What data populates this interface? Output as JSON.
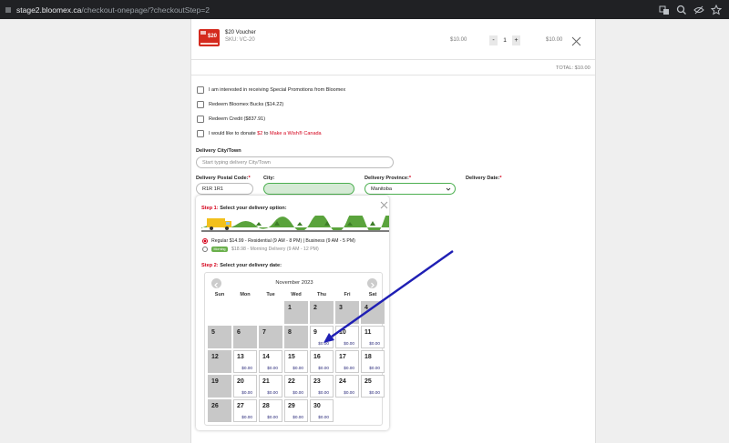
{
  "browser": {
    "url_host": "stage2.bloomex.ca",
    "url_path": "/checkout-onepage/?checkoutStep=2"
  },
  "cart": {
    "item_name": "$20 Voucher",
    "item_sku": "SKU: VC-20",
    "voucher_image_text": "$20",
    "unit_price": "$10.00",
    "qty_minus": "-",
    "quantity": "1",
    "qty_plus": "+",
    "line_total": "$10.00",
    "total": "TOTAL: $10.00"
  },
  "options": {
    "promotions": "I am interested in receiving Special Promotions from Bloomex",
    "bucks": "Redeem Bloomex Bucks ($14.22)",
    "credit": "Redeem Credit ($837.91)",
    "donate_pre": "I would like to donate ",
    "donate_amount": "$2",
    "donate_mid": " to ",
    "donate_org": "Make a Wish® Canada"
  },
  "delivery": {
    "city_town_label": "Delivery City/Town",
    "city_town_placeholder": "Start typing delivery City/Town",
    "postal_label": "Delivery Postal Code:",
    "postal_value": "R1R 1R1",
    "city_label": "City:",
    "province_label": "Delivery Province:",
    "province_value": "Manitoba",
    "date_label": "Delivery Date:",
    "required_mark": "*"
  },
  "step1": {
    "step_word": "Step 1:",
    "title": " Select your delivery option:",
    "option_regular": "Regular $14.99 - Residential (9 AM - 8 PM) | Business (9 AM - 5 PM)",
    "option_morning": "$18.98 - Morning Delivery (9 AM - 12 PM)",
    "morning_badge": "Morning"
  },
  "step2": {
    "step_word": "Step 2:",
    "title": " Select your delivery date:"
  },
  "calendar": {
    "month": "November 2023",
    "weekdays": [
      "Sun",
      "Mon",
      "Tue",
      "Wed",
      "Thu",
      "Fri",
      "Sat"
    ],
    "weeks": [
      [
        null,
        null,
        null,
        {
          "day": "1",
          "price": "",
          "disabled": true
        },
        {
          "day": "2",
          "price": "",
          "disabled": true
        },
        {
          "day": "3",
          "price": "",
          "disabled": true
        },
        {
          "day": "4",
          "price": "",
          "disabled": true
        }
      ],
      [
        {
          "day": "5",
          "price": "",
          "disabled": true
        },
        {
          "day": "6",
          "price": "",
          "disabled": true
        },
        {
          "day": "7",
          "price": "",
          "disabled": true
        },
        {
          "day": "8",
          "price": "",
          "disabled": true
        },
        {
          "day": "9",
          "price": "$0.00",
          "disabled": false
        },
        {
          "day": "10",
          "price": "$0.00",
          "disabled": false
        },
        {
          "day": "11",
          "price": "$0.00",
          "disabled": false
        }
      ],
      [
        {
          "day": "12",
          "price": "",
          "disabled": true
        },
        {
          "day": "13",
          "price": "$0.00",
          "disabled": false
        },
        {
          "day": "14",
          "price": "$0.00",
          "disabled": false
        },
        {
          "day": "15",
          "price": "$0.00",
          "disabled": false
        },
        {
          "day": "16",
          "price": "$0.00",
          "disabled": false
        },
        {
          "day": "17",
          "price": "$0.00",
          "disabled": false
        },
        {
          "day": "18",
          "price": "$0.00",
          "disabled": false
        }
      ],
      [
        {
          "day": "19",
          "price": "",
          "disabled": true
        },
        {
          "day": "20",
          "price": "$0.00",
          "disabled": false
        },
        {
          "day": "21",
          "price": "$0.00",
          "disabled": false
        },
        {
          "day": "22",
          "price": "$0.00",
          "disabled": false
        },
        {
          "day": "23",
          "price": "$0.00",
          "disabled": false
        },
        {
          "day": "24",
          "price": "$0.00",
          "disabled": false
        },
        {
          "day": "25",
          "price": "$0.00",
          "disabled": false
        }
      ],
      [
        {
          "day": "26",
          "price": "",
          "disabled": true
        },
        {
          "day": "27",
          "price": "$0.00",
          "disabled": false
        },
        {
          "day": "28",
          "price": "$0.00",
          "disabled": false
        },
        {
          "day": "29",
          "price": "$0.00",
          "disabled": false
        },
        {
          "day": "30",
          "price": "$0.00",
          "disabled": false
        },
        null,
        null
      ]
    ]
  },
  "colors": {
    "accent_red": "#d4001a",
    "green_field": "#4caf50",
    "annotation_arrow": "#1f1fb4"
  }
}
